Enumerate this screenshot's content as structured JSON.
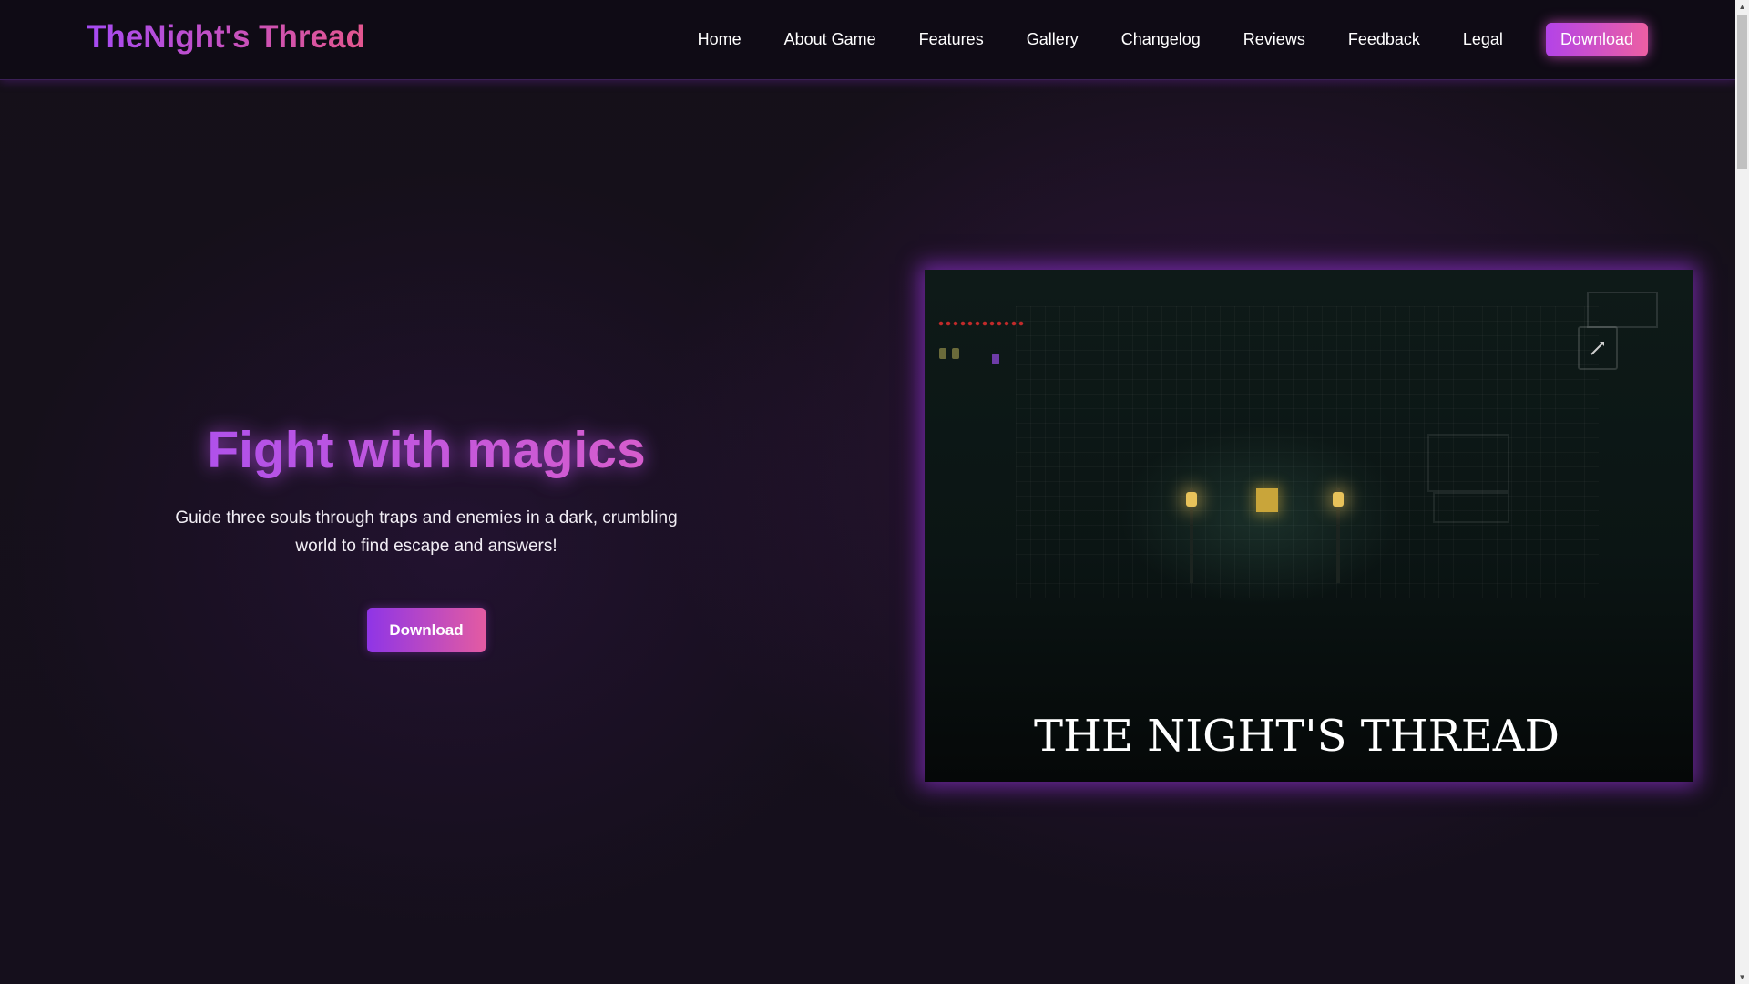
{
  "header": {
    "brand": "TheNight's Thread",
    "nav": [
      {
        "label": "Home"
      },
      {
        "label": "About Game"
      },
      {
        "label": "Features"
      },
      {
        "label": "Gallery"
      },
      {
        "label": "Changelog"
      },
      {
        "label": "Reviews"
      },
      {
        "label": "Feedback"
      },
      {
        "label": "Legal"
      }
    ],
    "download_label": "Download"
  },
  "hero": {
    "title": "Fight with magics",
    "subtitle": "Guide three souls through traps and enemies in a dark, crumbling world to find escape and answers!",
    "cta_label": "Download"
  },
  "screenshot": {
    "title_text": "THE NIGHT'S THREAD"
  },
  "colors": {
    "accent_purple": "#a64bf4",
    "accent_pink": "#e4568e",
    "background": "#151019"
  },
  "icons": {
    "scroll_up": "scroll-up-arrow-icon",
    "scroll_down": "scroll-down-arrow-icon",
    "weapon": "sword-icon"
  }
}
